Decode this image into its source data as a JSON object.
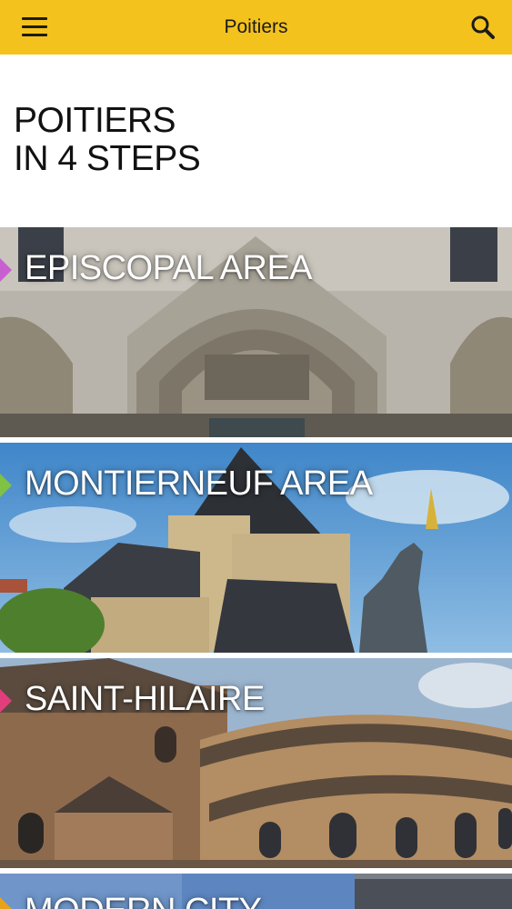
{
  "header": {
    "title": "Poitiers",
    "menu_icon": "hamburger-menu-icon",
    "search_icon": "search-icon",
    "background_color": "#f4c21d"
  },
  "intro": {
    "line1": "POITIERS",
    "line2": "IN 4 STEPS"
  },
  "areas": [
    {
      "label": "EPISCOPAL AREA",
      "marker_color": "#c85fd0"
    },
    {
      "label": "MONTIERNEUF AREA",
      "marker_color": "#7fc244"
    },
    {
      "label": "SAINT-HILAIRE",
      "marker_color": "#e23d7d"
    },
    {
      "label": "MODERN CITY",
      "marker_color": "#e8a21a"
    }
  ]
}
